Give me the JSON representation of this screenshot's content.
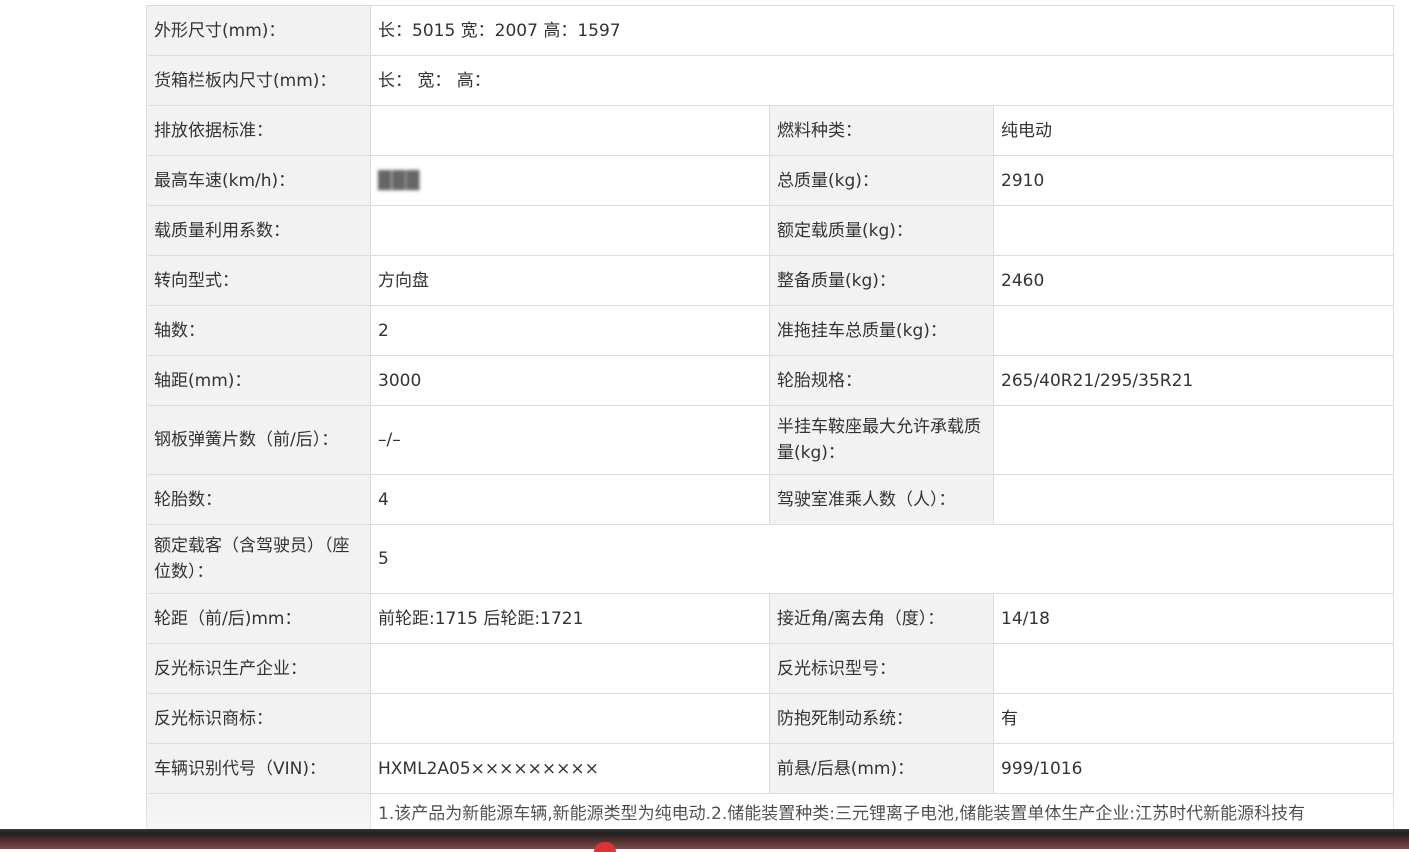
{
  "spec": {
    "dimensions": {
      "label": "外形尺寸(mm)：",
      "value": "长：5015 宽：2007 高：1597"
    },
    "cargo_box": {
      "label": "货箱栏板内尺寸(mm)：",
      "value": "长：  宽：  高："
    },
    "emission_std": {
      "label": "排放依据标准：",
      "value": ""
    },
    "fuel_type": {
      "label": "燃料种类：",
      "value": "纯电动"
    },
    "max_speed": {
      "label": "最高车速(km/h)：",
      "value": "███"
    },
    "gross_mass": {
      "label": "总质量(kg)：",
      "value": "2910"
    },
    "load_factor": {
      "label": "载质量利用系数：",
      "value": ""
    },
    "rated_load": {
      "label": "额定载质量(kg)：",
      "value": ""
    },
    "steering": {
      "label": "转向型式：",
      "value": "方向盘"
    },
    "curb_mass": {
      "label": "整备质量(kg)：",
      "value": "2460"
    },
    "axles": {
      "label": "轴数：",
      "value": "2"
    },
    "trailer_mass": {
      "label": "准拖挂车总质量(kg)：",
      "value": ""
    },
    "wheelbase": {
      "label": "轴距(mm)：",
      "value": "3000"
    },
    "tire_spec": {
      "label": "轮胎规格：",
      "value": "265/40R21/295/35R21"
    },
    "leaf_springs": {
      "label": "钢板弹簧片数（前/后）：",
      "value": "–/–"
    },
    "saddle_load": {
      "label": "半挂车鞍座最大允许承载质量(kg)：",
      "value": ""
    },
    "tire_count": {
      "label": "轮胎数：",
      "value": "4"
    },
    "cab_passengers": {
      "label": "驾驶室准乘人数（人）：",
      "value": ""
    },
    "rated_passengers": {
      "label": "额定载客（含驾驶员）（座位数）：",
      "value": "5"
    },
    "track": {
      "label": "轮距（前/后)mm：",
      "value": "前轮距:1715 后轮距:1721"
    },
    "angles": {
      "label": "接近角/离去角（度）：",
      "value": "14/18"
    },
    "reflector_maker": {
      "label": "反光标识生产企业：",
      "value": ""
    },
    "reflector_model": {
      "label": "反光标识型号：",
      "value": ""
    },
    "reflector_brand": {
      "label": "反光标识商标：",
      "value": ""
    },
    "abs": {
      "label": "防抱死制动系统：",
      "value": "有"
    },
    "vin": {
      "label": "车辆识别代号（VIN)：",
      "value": "HXML2A05×××××××××"
    },
    "overhang": {
      "label": "前悬/后悬(mm)：",
      "value": "999/1016"
    },
    "remarks": {
      "label": "",
      "value": "1.该产品为新能源车辆,新能源类型为纯电动.2.储能装置种类:三元锂离子电池,储能装置单体生产企业:江苏时代新能源科技有"
    }
  }
}
